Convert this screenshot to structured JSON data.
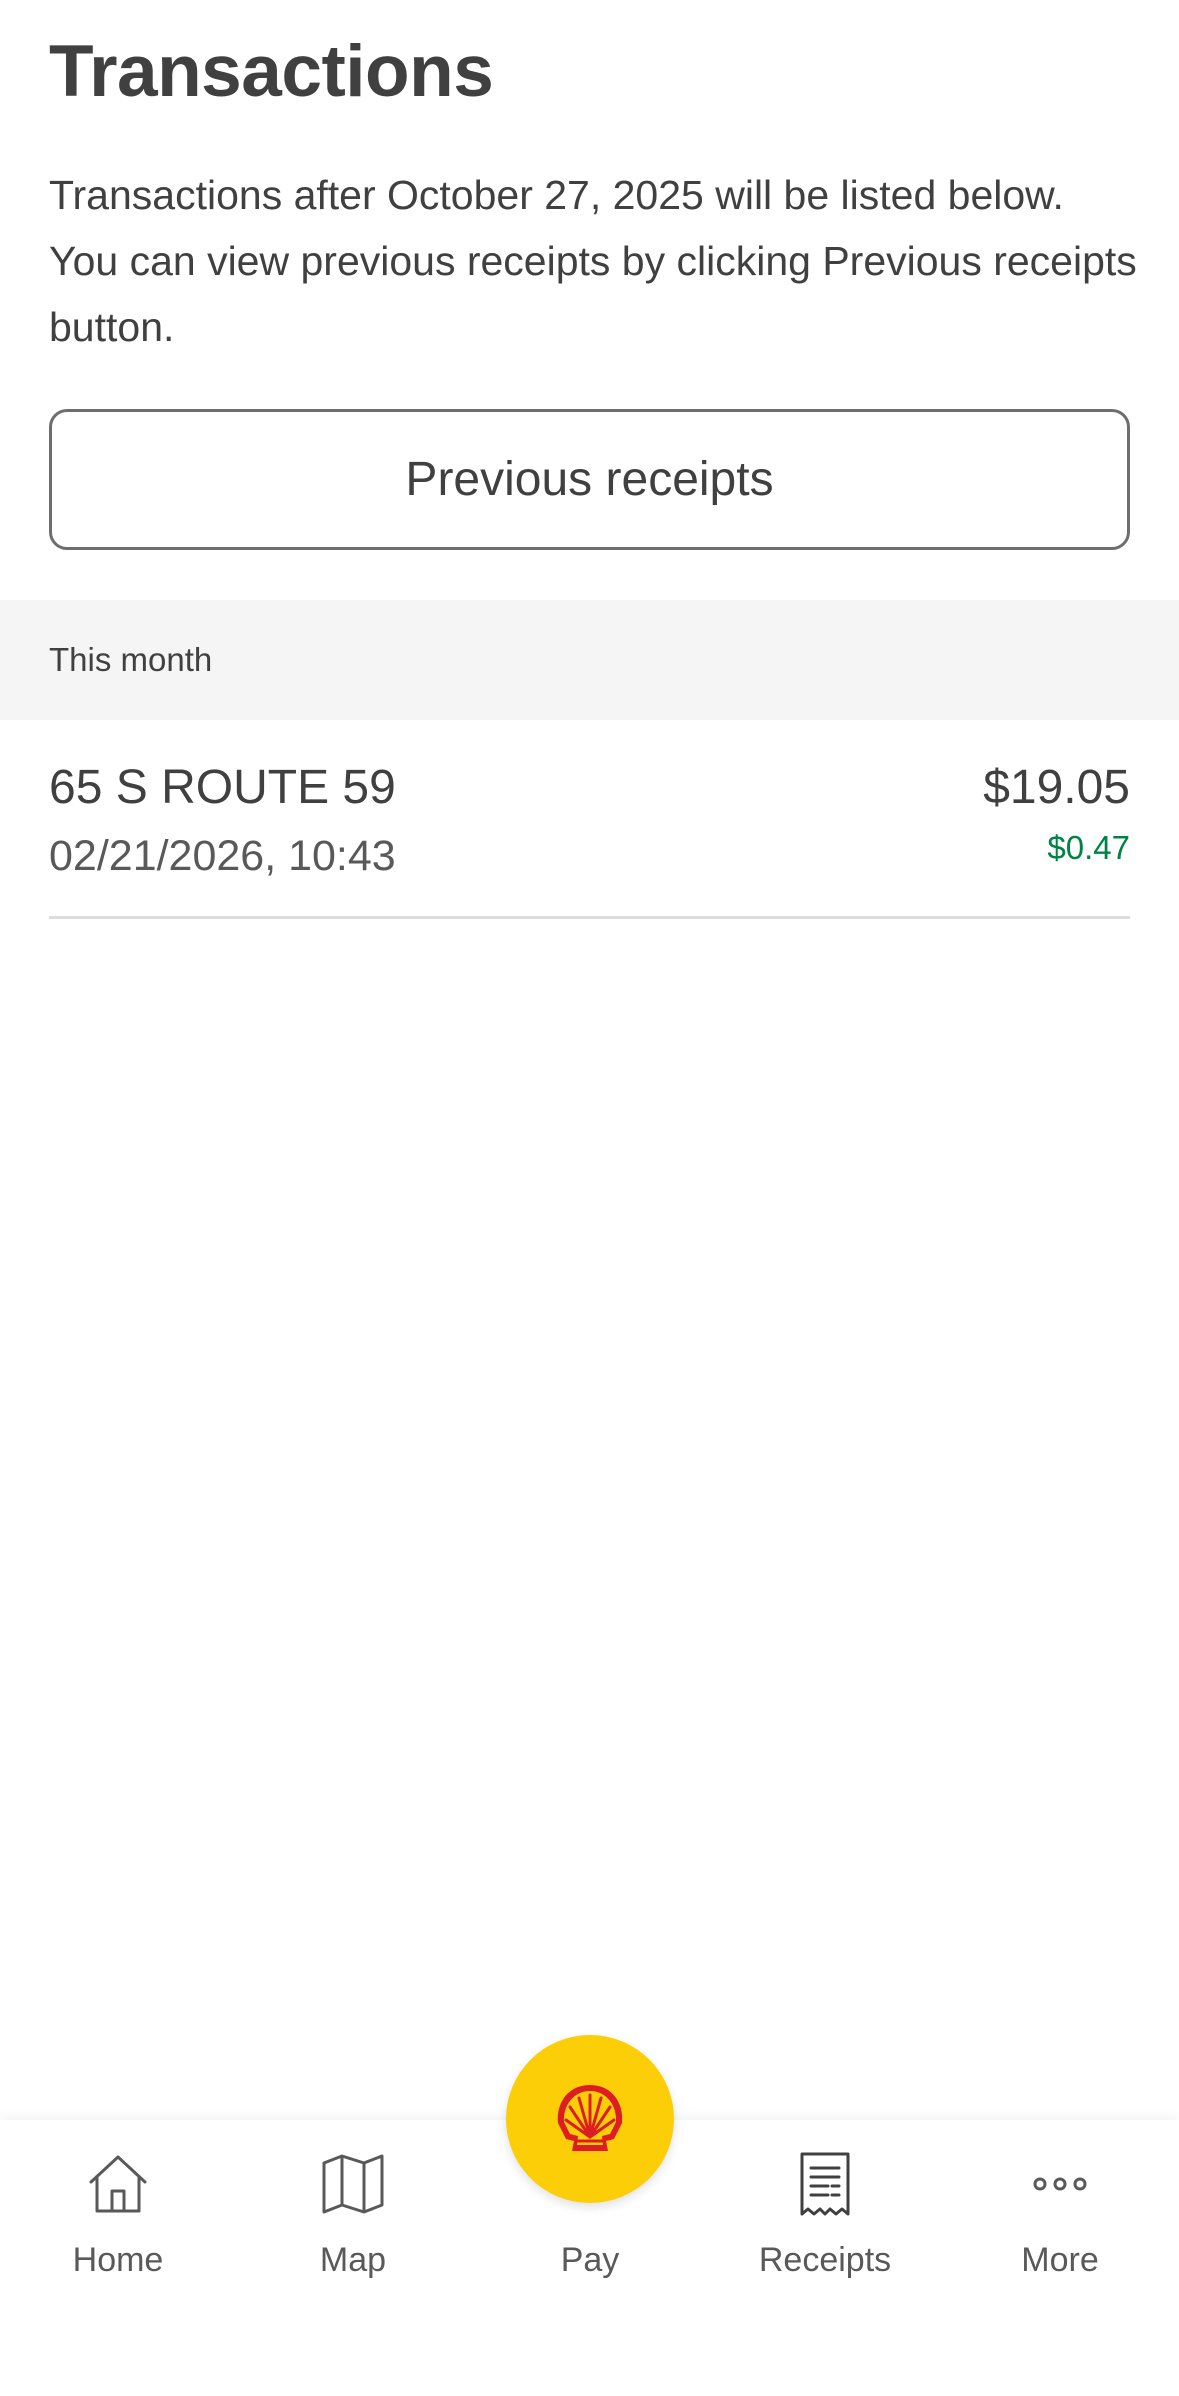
{
  "header": {
    "title": "Transactions"
  },
  "intro": {
    "text": "Transactions after October 27, 2025 will be listed below. You can view previous receipts by clicking Previous receipts button."
  },
  "previous_receipts_button": {
    "label": "Previous receipts"
  },
  "section": {
    "label": "This month"
  },
  "transactions": [
    {
      "station": "65 S ROUTE 59",
      "datetime": "02/21/2026, 10:43",
      "amount": "$19.05",
      "savings": "$0.47"
    }
  ],
  "tabs": {
    "home": {
      "label": "Home",
      "icon": "home-icon"
    },
    "map": {
      "label": "Map",
      "icon": "map-icon"
    },
    "pay": {
      "label": "Pay",
      "icon": "shell-logo-icon"
    },
    "receipts": {
      "label": "Receipts",
      "icon": "receipt-icon",
      "active": true
    },
    "more": {
      "label": "More",
      "icon": "more-dots-icon"
    }
  },
  "colors": {
    "shell_yellow": "#FBCE07",
    "shell_red": "#DD1D21",
    "savings_green": "#008443",
    "text_dark": "#404040"
  }
}
